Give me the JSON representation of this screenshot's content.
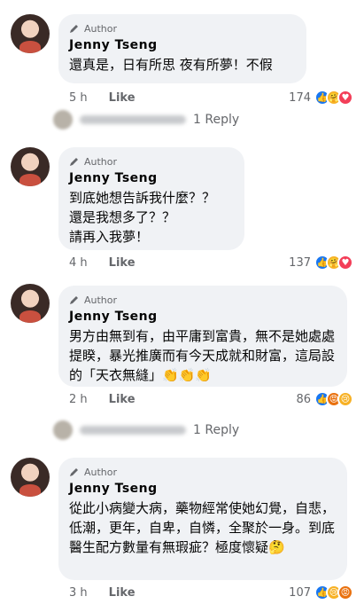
{
  "comments": [
    {
      "badge": "Author",
      "name": "Jenny Tseng",
      "text": "還真是，日有所思 夜有所夢！不假",
      "time": "5 h",
      "like": "Like",
      "reaction_count": "174",
      "reactions": [
        "like",
        "care",
        "love"
      ]
    },
    {
      "badge": "Author",
      "name": "Jenny Tseng",
      "text": "到底她想告訴我什麼？？\n還是我想多了？？\n請再入我夢！",
      "time": "4 h",
      "like": "Like",
      "reaction_count": "137",
      "reactions": [
        "like",
        "care",
        "love"
      ]
    },
    {
      "badge": "Author",
      "name": "Jenny Tseng",
      "text": "男方由無到有，由平庸到富貴，無不是她處處提睽，暴光推廣而有今天成就和財富，這局設的「天衣無縫」👏👏👏",
      "time": "2 h",
      "like": "Like",
      "reaction_count": "86",
      "reactions": [
        "like",
        "angry",
        "sad"
      ]
    },
    {
      "badge": "Author",
      "name": "Jenny Tseng",
      "text": "從此小病變大病，藥物經常使她幻覺，自悲，低潮，更年，自卑，自憐，全聚於一身。到底醫生配方數量有無瑕疵？極度懷疑🤔",
      "time": "3 h",
      "like": "Like",
      "reaction_count": "107",
      "reactions": [
        "like",
        "sad",
        "angry"
      ]
    }
  ],
  "replies": [
    {
      "text": "1 Reply"
    },
    {
      "text": "1 Reply"
    }
  ],
  "icons": {
    "pencil": "pencil-icon",
    "like": "like-reaction-icon",
    "love": "love-reaction-icon",
    "care": "care-reaction-icon",
    "angry": "angry-reaction-icon",
    "sad": "sad-reaction-icon"
  },
  "colors": {
    "bubble": "#f0f2f5",
    "meta": "#65676b",
    "like": "#1877f2",
    "love": "#f33e58"
  }
}
